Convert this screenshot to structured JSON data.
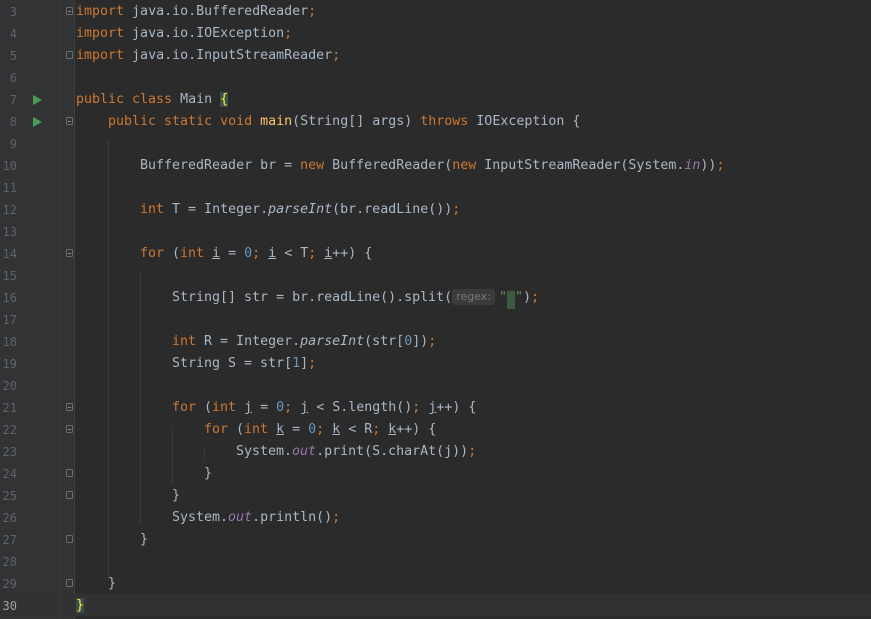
{
  "editor": {
    "current_line": "30",
    "lines": [
      {
        "n": "3"
      },
      {
        "n": "4"
      },
      {
        "n": "5"
      },
      {
        "n": "6"
      },
      {
        "n": "7"
      },
      {
        "n": "8"
      },
      {
        "n": "9"
      },
      {
        "n": "10"
      },
      {
        "n": "11"
      },
      {
        "n": "12"
      },
      {
        "n": "13"
      },
      {
        "n": "14"
      },
      {
        "n": "15"
      },
      {
        "n": "16"
      },
      {
        "n": "17"
      },
      {
        "n": "18"
      },
      {
        "n": "19"
      },
      {
        "n": "20"
      },
      {
        "n": "21"
      },
      {
        "n": "22"
      },
      {
        "n": "23"
      },
      {
        "n": "24"
      },
      {
        "n": "25"
      },
      {
        "n": "26"
      },
      {
        "n": "27"
      },
      {
        "n": "28"
      },
      {
        "n": "29"
      },
      {
        "n": "30"
      }
    ],
    "code": {
      "l3": [
        [
          "kw",
          "import"
        ],
        [
          "p",
          " java.io.BufferedReader"
        ],
        [
          "kw",
          ";"
        ]
      ],
      "l4": [
        [
          "kw",
          "import"
        ],
        [
          "p",
          " java.io.IOException"
        ],
        [
          "kw",
          ";"
        ]
      ],
      "l5": [
        [
          "kw",
          "import"
        ],
        [
          "p",
          " java.io.InputStreamReader"
        ],
        [
          "kw",
          ";"
        ]
      ],
      "l7": [
        [
          "kw",
          "public class"
        ],
        [
          "p",
          " Main "
        ],
        [
          "bm",
          "{"
        ]
      ],
      "l8": [
        [
          "kw",
          "public static void"
        ],
        [
          "p",
          " "
        ],
        [
          "fn",
          "main"
        ],
        [
          "p",
          "(String[] args) "
        ],
        [
          "kw",
          "throws"
        ],
        [
          "p",
          " IOException {"
        ]
      ],
      "l10": [
        [
          "p",
          "BufferedReader br = "
        ],
        [
          "kw",
          "new"
        ],
        [
          "p",
          " BufferedReader("
        ],
        [
          "kw",
          "new"
        ],
        [
          "p",
          " InputStreamReader(System."
        ],
        [
          "sf",
          "in"
        ],
        [
          "p",
          "))"
        ],
        [
          "kw",
          ";"
        ]
      ],
      "l12": [
        [
          "kw",
          "int"
        ],
        [
          "p",
          " T = Integer."
        ],
        [
          "it",
          "parseInt"
        ],
        [
          "p",
          "(br.readLine())"
        ],
        [
          "kw",
          ";"
        ]
      ],
      "l14": [
        [
          "kw",
          "for"
        ],
        [
          "p",
          " ("
        ],
        [
          "kw",
          "int"
        ],
        [
          "p",
          " "
        ],
        [
          "ul",
          "i"
        ],
        [
          "p",
          " = "
        ],
        [
          "num",
          "0"
        ],
        [
          "kw",
          ";"
        ],
        [
          "p",
          " "
        ],
        [
          "ul",
          "i"
        ],
        [
          "p",
          " < T"
        ],
        [
          "kw",
          ";"
        ],
        [
          "p",
          " "
        ],
        [
          "ul",
          "i"
        ],
        [
          "p",
          "++) {"
        ]
      ],
      "l16": [
        [
          "p",
          "String[] str = br.readLine().split("
        ],
        [
          "hint",
          "regex:"
        ],
        [
          "str",
          "\""
        ],
        [
          "caret",
          " "
        ],
        [
          "str",
          "\""
        ],
        [
          "p",
          ")"
        ],
        [
          "kw",
          ";"
        ]
      ],
      "l18": [
        [
          "kw",
          "int"
        ],
        [
          "p",
          " R = Integer."
        ],
        [
          "it",
          "parseInt"
        ],
        [
          "p",
          "(str["
        ],
        [
          "num",
          "0"
        ],
        [
          "p",
          "])"
        ],
        [
          "kw",
          ";"
        ]
      ],
      "l19": [
        [
          "p",
          "String S = str["
        ],
        [
          "num",
          "1"
        ],
        [
          "p",
          "]"
        ],
        [
          "kw",
          ";"
        ]
      ],
      "l21": [
        [
          "kw",
          "for"
        ],
        [
          "p",
          " ("
        ],
        [
          "kw",
          "int"
        ],
        [
          "p",
          " "
        ],
        [
          "ul",
          "j"
        ],
        [
          "p",
          " = "
        ],
        [
          "num",
          "0"
        ],
        [
          "kw",
          ";"
        ],
        [
          "p",
          " "
        ],
        [
          "ul",
          "j"
        ],
        [
          "p",
          " < S.length()"
        ],
        [
          "kw",
          ";"
        ],
        [
          "p",
          " "
        ],
        [
          "ul",
          "j"
        ],
        [
          "p",
          "++) {"
        ]
      ],
      "l22": [
        [
          "kw",
          "for"
        ],
        [
          "p",
          " ("
        ],
        [
          "kw",
          "int"
        ],
        [
          "p",
          " "
        ],
        [
          "ul",
          "k"
        ],
        [
          "p",
          " = "
        ],
        [
          "num",
          "0"
        ],
        [
          "kw",
          ";"
        ],
        [
          "p",
          " "
        ],
        [
          "ul",
          "k"
        ],
        [
          "p",
          " < R"
        ],
        [
          "kw",
          ";"
        ],
        [
          "p",
          " "
        ],
        [
          "ul",
          "k"
        ],
        [
          "p",
          "++) {"
        ]
      ],
      "l23": [
        [
          "p",
          "System."
        ],
        [
          "sf",
          "out"
        ],
        [
          "p",
          ".print(S.charAt(j))"
        ],
        [
          "kw",
          ";"
        ]
      ],
      "l24": [
        [
          "p",
          "}"
        ]
      ],
      "l25": [
        [
          "p",
          "}"
        ]
      ],
      "l26": [
        [
          "p",
          "System."
        ],
        [
          "sf",
          "out"
        ],
        [
          "p",
          ".println()"
        ],
        [
          "kw",
          ";"
        ]
      ],
      "l27": [
        [
          "p",
          "}"
        ]
      ],
      "l29": [
        [
          "p",
          "}"
        ]
      ],
      "l30": [
        [
          "bm",
          "}"
        ]
      ]
    }
  }
}
